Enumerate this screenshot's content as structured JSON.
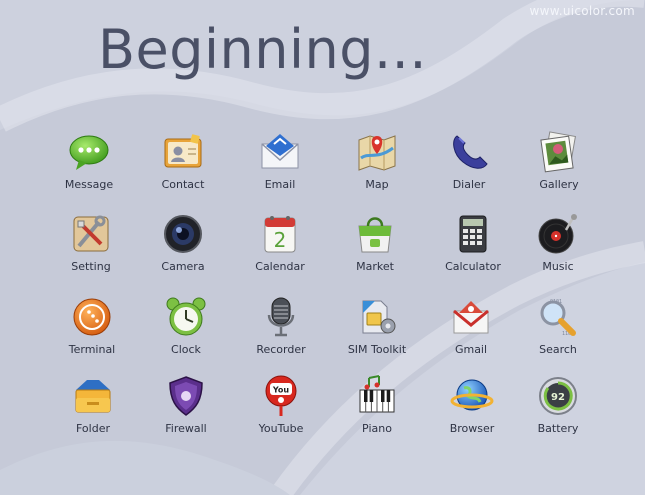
{
  "header": {
    "watermark": "www.uicolor.com",
    "title": "Beginning..."
  },
  "rows": [
    [
      {
        "label": "Message",
        "icon": "message-icon"
      },
      {
        "label": "Contact",
        "icon": "contact-icon"
      },
      {
        "label": "Email",
        "icon": "email-icon"
      },
      {
        "label": "Map",
        "icon": "map-icon"
      },
      {
        "label": "Dialer",
        "icon": "dialer-icon"
      },
      {
        "label": "Gallery",
        "icon": "gallery-icon"
      }
    ],
    [
      {
        "label": "Setting",
        "icon": "setting-icon"
      },
      {
        "label": "Camera",
        "icon": "camera-icon"
      },
      {
        "label": "Calendar",
        "icon": "calendar-icon",
        "badge": "2"
      },
      {
        "label": "Market",
        "icon": "market-icon"
      },
      {
        "label": "Calculator",
        "icon": "calculator-icon"
      },
      {
        "label": "Music",
        "icon": "music-icon"
      }
    ],
    [
      {
        "label": "Terminal",
        "icon": "terminal-icon"
      },
      {
        "label": "Clock",
        "icon": "clock-icon"
      },
      {
        "label": "Recorder",
        "icon": "recorder-icon"
      },
      {
        "label": "SIM  Toolkit",
        "icon": "sim-toolkit-icon"
      },
      {
        "label": "Gmail",
        "icon": "gmail-icon"
      },
      {
        "label": "Search",
        "icon": "search-icon"
      }
    ],
    [
      {
        "label": "Folder",
        "icon": "folder-icon"
      },
      {
        "label": "Firewall",
        "icon": "firewall-icon"
      },
      {
        "label": "YouTube",
        "icon": "youtube-icon",
        "badge": "You"
      },
      {
        "label": "Piano",
        "icon": "piano-icon"
      },
      {
        "label": "Browser",
        "icon": "browser-icon"
      },
      {
        "label": "Battery",
        "icon": "battery-icon",
        "badge": "92"
      }
    ]
  ],
  "colors": {
    "background": "#c8ccd9",
    "title": "#4a5066",
    "label": "#2e3344",
    "watermark": "#f4f6fb"
  }
}
